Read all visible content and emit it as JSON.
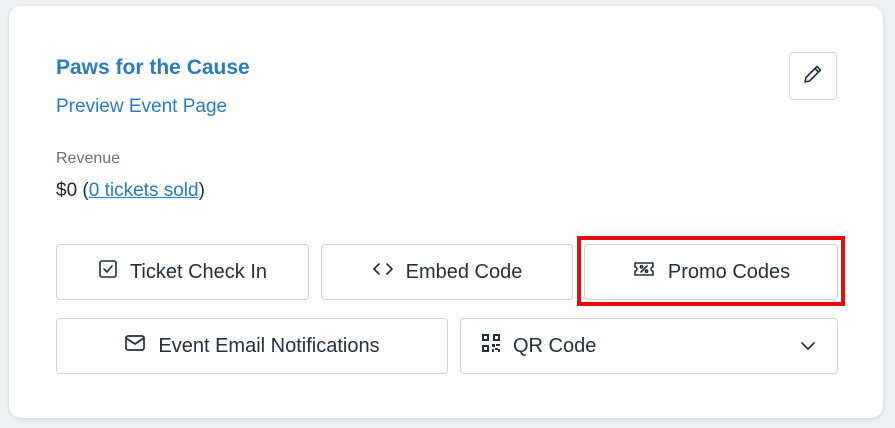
{
  "event": {
    "title": "Paws for the Cause",
    "preview_link": "Preview Event Page"
  },
  "revenue": {
    "label": "Revenue",
    "amount": "$0",
    "paren_open": " (",
    "tickets_link": "0 tickets sold",
    "paren_close": ")"
  },
  "actions": {
    "ticket_check_in": "Ticket Check In",
    "embed_code": "Embed Code",
    "promo_codes": "Promo Codes",
    "event_email_notifications": "Event Email Notifications",
    "qr_code": "QR Code"
  },
  "icons": {
    "edit": "pencil-icon",
    "check_in": "checkbox-icon",
    "embed": "code-brackets-icon",
    "promo": "ticket-percent-icon",
    "email": "envelope-icon",
    "qr": "qr-code-icon",
    "dropdown": "chevron-down-icon"
  },
  "colors": {
    "link": "#2b7bbd",
    "highlight": "#e30d0d"
  }
}
